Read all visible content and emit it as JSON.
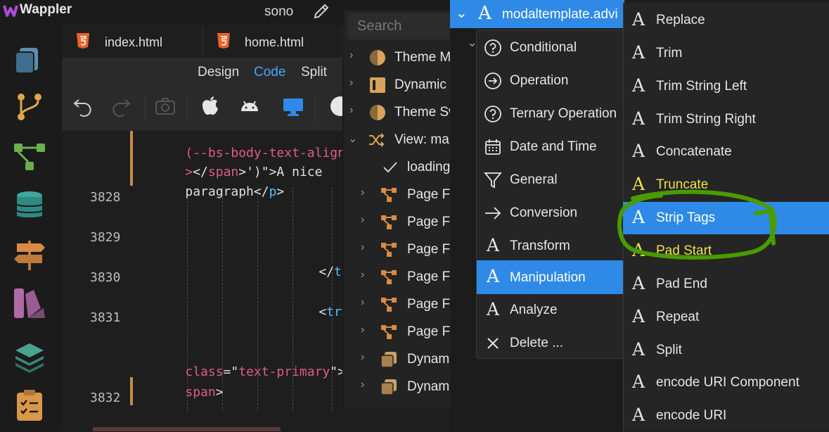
{
  "app": {
    "name": "Wappler",
    "project": "sono"
  },
  "tabs": [
    {
      "label": "index.html"
    },
    {
      "label": "home.html"
    }
  ],
  "view_modes": {
    "design": "Design",
    "code": "Code",
    "split": "Split",
    "active": "Code"
  },
  "code": {
    "lines": [
      {
        "num": "",
        "parts": [
          [
            "pink",
            "(--bs-body-text-align"
          ]
        ]
      },
      {
        "num": "",
        "parts": [
          [
            "pink",
            ">"
          ],
          [
            "white",
            "</"
          ],
          [
            "pink",
            "span"
          ],
          [
            "white",
            ">')\">A nice"
          ]
        ]
      },
      {
        "num": "",
        "parts": [
          [
            "white",
            "paragraph</"
          ],
          [
            "cyan",
            "p"
          ],
          [
            "white",
            ">"
          ]
        ]
      },
      {
        "num": "3828",
        "parts": []
      },
      {
        "num": "",
        "parts": [
          [
            "white",
            "</"
          ]
        ]
      },
      {
        "num": "3829",
        "parts": []
      },
      {
        "num": "",
        "parts": [
          [
            "white",
            "</"
          ],
          [
            "cyan",
            "tr"
          ],
          [
            "white",
            ">"
          ]
        ]
      },
      {
        "num": "3830",
        "parts": []
      },
      {
        "num": "",
        "parts": [
          [
            "white",
            "<"
          ],
          [
            "cyan",
            "tr"
          ],
          [
            "white",
            ">"
          ]
        ]
      },
      {
        "num": "3831",
        "parts": []
      },
      {
        "num": "",
        "parts": [
          [
            "white",
            "<"
          ],
          [
            "cyan",
            "t"
          ]
        ]
      },
      {
        "num": "",
        "parts": [
          [
            "pink",
            "class"
          ],
          [
            "white",
            "=\""
          ],
          [
            "pink",
            "text-primary"
          ],
          [
            "white",
            "\">"
          ]
        ]
      },
      {
        "num": "",
        "parts": [
          [
            "pink",
            "span"
          ],
          [
            "white",
            ">"
          ]
        ]
      },
      {
        "num": "3832",
        "parts": []
      }
    ]
  },
  "tree": {
    "search_placeholder": "Search",
    "rows": [
      {
        "label": "Theme M",
        "icon": "theme-icon",
        "chev": "›"
      },
      {
        "label": "Dynamic",
        "icon": "panel-icon",
        "chev": "›"
      },
      {
        "label": "Theme Sw",
        "icon": "theme-icon",
        "chev": "›"
      },
      {
        "label": "View: ma",
        "icon": "shuffle-icon",
        "chev": "⌄"
      },
      {
        "label": "loading",
        "icon": "check-icon",
        "chev": ""
      },
      {
        "label": "Page Fl",
        "icon": "flow-icon",
        "chev": "›"
      },
      {
        "label": "Page Fl",
        "icon": "flow-icon",
        "chev": "›"
      },
      {
        "label": "Page Fl",
        "icon": "flow-icon",
        "chev": "›"
      },
      {
        "label": "Page Fl",
        "icon": "flow-icon",
        "chev": "›"
      },
      {
        "label": "Page Fl",
        "icon": "flow-icon",
        "chev": "›"
      },
      {
        "label": "Page Fl",
        "icon": "flow-icon",
        "chev": "›"
      },
      {
        "label": "Dynam",
        "icon": "copy-icon",
        "chev": "›"
      },
      {
        "label": "Dynam",
        "icon": "copy-icon",
        "chev": "›"
      }
    ]
  },
  "selected_node": {
    "label": "modaltemplate.advi"
  },
  "context_menu": {
    "items": [
      {
        "label": "Conditional",
        "icon": "question-circle-icon"
      },
      {
        "label": "Operation",
        "icon": "arrow-circle-icon"
      },
      {
        "label": "Ternary Operation",
        "icon": "question-circle-icon"
      },
      {
        "label": "Date and Time",
        "icon": "calendar-icon"
      },
      {
        "label": "General",
        "icon": "filter-icon"
      },
      {
        "label": "Conversion",
        "icon": "arrow-right-icon"
      },
      {
        "label": "Transform",
        "icon": "letter-a-icon"
      },
      {
        "label": "Manipulation",
        "icon": "letter-a-icon",
        "active": true
      },
      {
        "label": "Analyze",
        "icon": "letter-a-icon"
      },
      {
        "label": "Delete ...",
        "icon": "close-icon"
      }
    ]
  },
  "submenu": {
    "items": [
      {
        "label": "Replace"
      },
      {
        "label": "Trim"
      },
      {
        "label": "Trim String Left"
      },
      {
        "label": "Trim String Right"
      },
      {
        "label": "Concatenate"
      },
      {
        "label": "Truncate",
        "style": "yellow"
      },
      {
        "label": "Strip Tags",
        "style": "active"
      },
      {
        "label": "Pad Start",
        "style": "yellow"
      },
      {
        "label": "Pad End"
      },
      {
        "label": "Repeat"
      },
      {
        "label": "Split"
      },
      {
        "label": "encode URI Component"
      },
      {
        "label": "encode URI"
      }
    ],
    "glyph": "A"
  },
  "colors": {
    "accent": "#2e8ae6",
    "highlight_annotation": "#4a9a00"
  }
}
